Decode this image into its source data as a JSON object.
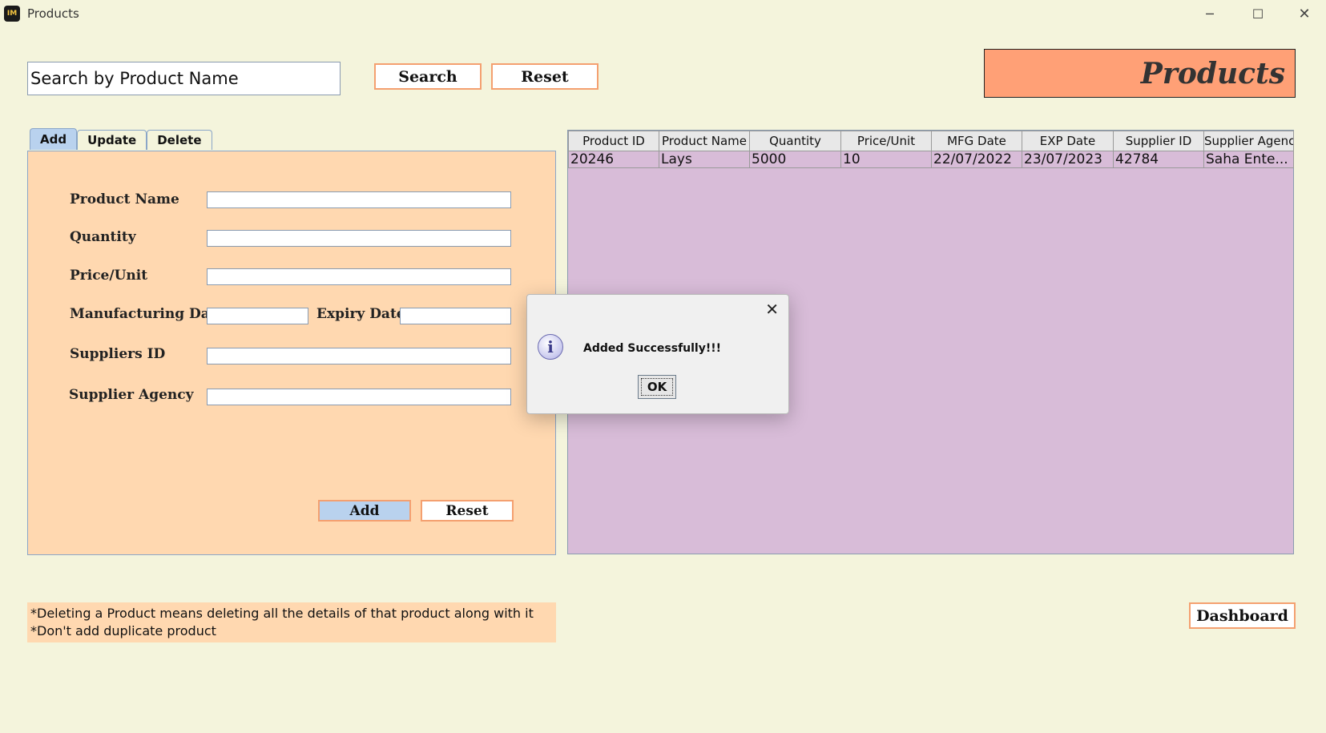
{
  "window": {
    "title": "Products",
    "icon_text": "IM",
    "controls": {
      "minimize": "─",
      "maximize": "☐",
      "close": "✕"
    }
  },
  "search": {
    "value": "Search by Product Name",
    "search_label": "Search",
    "reset_label": "Reset"
  },
  "header": {
    "title": "Products"
  },
  "tabs": [
    {
      "label": "Add",
      "active": true
    },
    {
      "label": "Update",
      "active": false
    },
    {
      "label": "Delete",
      "active": false
    }
  ],
  "form": {
    "product_name_label": "Product Name",
    "quantity_label": "Quantity",
    "price_label": "Price/Unit",
    "mfg_label": "Manufacturing Date",
    "exp_label": "Expiry Date",
    "supplier_id_label": "Suppliers ID",
    "supplier_agency_label": "Supplier Agency",
    "add_label": "Add",
    "reset_label": "Reset"
  },
  "table": {
    "columns": [
      "Product ID",
      "Product Name",
      "Quantity",
      "Price/Unit",
      "MFG Date",
      "EXP Date",
      "Supplier ID",
      "Supplier Agency"
    ],
    "rows": [
      [
        "20246",
        "Lays",
        "5000",
        "10",
        "22/07/2022",
        "23/07/2023",
        "42784",
        "Saha Ente..."
      ]
    ]
  },
  "dialog": {
    "message": "Added Successfully!!!",
    "ok_label": "OK",
    "close_glyph": "✕",
    "icon": "info-icon"
  },
  "notes": {
    "line1": "*Deleting a Product means deleting all the details of that product along with it",
    "line2": "*Don't add duplicate product"
  },
  "footer": {
    "dashboard_label": "Dashboard"
  },
  "colors": {
    "background": "#f4f4dc",
    "panel": "#ffd8b0",
    "title_box": "#ffa076",
    "table_bg": "#d8bcd8",
    "accent_border": "#f4a070",
    "selected_tab": "#b9d2ee"
  }
}
